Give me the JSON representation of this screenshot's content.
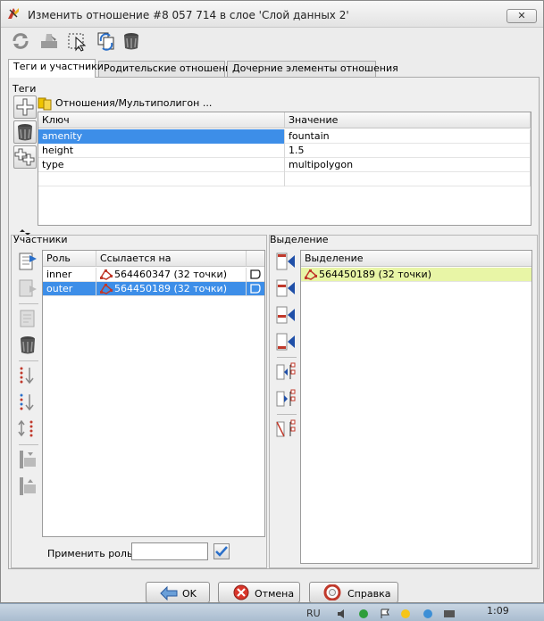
{
  "window": {
    "title": "Изменить отношение #8 057 714 в слое 'Слой данных 2'",
    "close_label": "✕"
  },
  "toolbar": {
    "icons": [
      "refresh-icon",
      "stamp-icon",
      "select-icon",
      "copy-icon",
      "delete-icon"
    ]
  },
  "tabs": [
    {
      "label": "Теги и участники",
      "active": true
    },
    {
      "label": "Родительские отношения",
      "active": false
    },
    {
      "label": "Дочерние элементы отношения",
      "active": false
    }
  ],
  "tags": {
    "section_label": "Теги",
    "relation_name": "Отношения/Мультиполигон ...",
    "columns": [
      "Ключ",
      "Значение"
    ],
    "rows": [
      {
        "key": "amenity",
        "value": "fountain",
        "selected": true
      },
      {
        "key": "height",
        "value": "1.5",
        "selected": false
      },
      {
        "key": "type",
        "value": "multipolygon",
        "selected": false
      },
      {
        "key": "",
        "value": "",
        "selected": false
      }
    ]
  },
  "members": {
    "section_label": "Участники",
    "columns": [
      "Роль",
      "Ссылается на"
    ],
    "rows": [
      {
        "role": "inner",
        "ref": "564460347 (32 точки)",
        "selected": false
      },
      {
        "role": "outer",
        "ref": "564450189 (32 точки)",
        "selected": true
      }
    ],
    "apply_role_label": "Применить роль:",
    "apply_role_value": ""
  },
  "selection": {
    "section_label": "Выделение",
    "column": "Выделение",
    "rows": [
      {
        "ref": "564450189 (32 точки)"
      }
    ]
  },
  "buttons": {
    "ok": "OK",
    "cancel": "Отмена",
    "help": "Справка"
  },
  "taskbar": {
    "lang": "RU",
    "time": "1:09"
  },
  "colors": {
    "selection_blue": "#3d8ee8",
    "selection_yellow": "#e8f5a6"
  }
}
